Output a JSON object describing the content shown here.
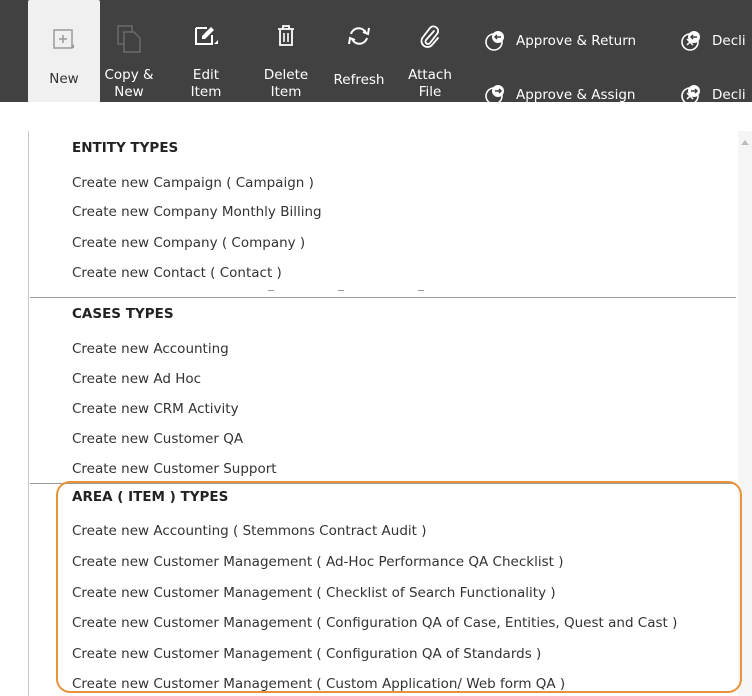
{
  "toolbar": {
    "new_line1": "New",
    "copy_line1": "Copy &",
    "copy_line2": "New",
    "edit_line1": "Edit",
    "edit_line2": "Item",
    "delete_line1": "Delete",
    "delete_line2": "Item",
    "refresh": "Refresh",
    "attach_line1": "Attach",
    "attach_line2": "File",
    "approve_return": "Approve & Return",
    "approve_assign": "Approve & Assign",
    "decline_1": "Decli",
    "decline_2": "Decli"
  },
  "menu": {
    "entity_types": {
      "title": "ENTITY TYPES",
      "items": [
        "Create new Campaign ( Campaign )",
        "Create new Company Monthly Billing",
        "Create new Company ( Company )",
        "Create new Contact ( Contact )"
      ]
    },
    "cases_types": {
      "title": "CASES TYPES",
      "items": [
        "Create new Accounting",
        "Create new Ad Hoc",
        "Create new CRM Activity",
        "Create new Customer QA",
        "Create new Customer Support"
      ]
    },
    "area_types": {
      "title": "AREA ( ITEM ) TYPES",
      "items": [
        "Create new Accounting ( Stemmons Contract Audit )",
        "Create new Customer Management ( Ad-Hoc Performance QA Checklist )",
        "Create new Customer Management ( Checklist of Search Functionality )",
        "Create new Customer Management ( Configuration QA of Case, Entities, Quest and Cast )",
        "Create new Customer Management ( Configuration QA of Standards )",
        "Create new Customer Management ( Custom Application/ Web form QA )"
      ]
    }
  },
  "colors": {
    "toolbar_bg": "#414141",
    "highlight": "#e69339"
  }
}
